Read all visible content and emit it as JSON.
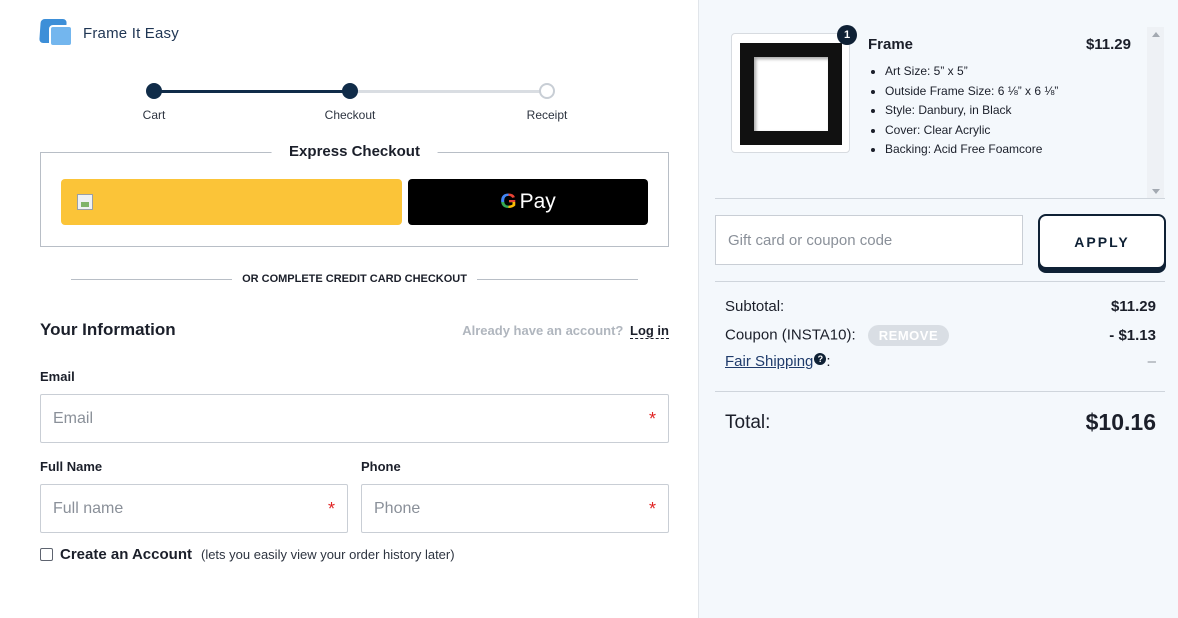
{
  "brand": {
    "name": "Frame It Easy"
  },
  "steps": [
    {
      "label": "Cart",
      "state": "done"
    },
    {
      "label": "Checkout",
      "state": "current"
    },
    {
      "label": "Receipt",
      "state": "todo"
    }
  ],
  "express": {
    "title": "Express Checkout",
    "gpay_label": "Pay",
    "gpay_g": "G"
  },
  "divider_text": "OR COMPLETE CREDIT CARD CHECKOUT",
  "your_info": {
    "title": "Your Information",
    "account_question": "Already have an account?",
    "login_link": "Log in"
  },
  "fields": {
    "email": {
      "label": "Email",
      "placeholder": "Email",
      "required_mark": "*"
    },
    "full_name": {
      "label": "Full Name",
      "placeholder": "Full name",
      "required_mark": "*"
    },
    "phone": {
      "label": "Phone",
      "placeholder": "Phone",
      "required_mark": "*"
    }
  },
  "create_account": {
    "label": "Create an Account",
    "hint": "(lets you easily view your order history later)",
    "checked": false
  },
  "cart": {
    "quantity": "1",
    "item_name": "Frame",
    "item_price": "$11.29",
    "specs": [
      "Art Size: 5” x 5”",
      "Outside Frame Size: 6 ⅛” x 6 ⅛”",
      "Style: Danbury, in Black",
      "Cover: Clear Acrylic",
      "Backing: Acid Free Foamcore"
    ]
  },
  "coupon": {
    "placeholder": "Gift card or coupon code",
    "apply_label": "APPLY"
  },
  "summary": {
    "subtotal_label": "Subtotal:",
    "subtotal_value": "$11.29",
    "coupon_label": "Coupon (INSTA10):",
    "remove_label": "REMOVE",
    "coupon_value": "- $1.13",
    "shipping_label": "Fair Shipping",
    "shipping_help": "?",
    "shipping_colon": ":",
    "shipping_value": "–",
    "total_label": "Total:",
    "total_value": "$10.16"
  },
  "colors": {
    "navy": "#0f2135",
    "paypal_yellow": "#fbc438",
    "required_red": "#e02424",
    "panel_bg": "#f4f8fc"
  }
}
